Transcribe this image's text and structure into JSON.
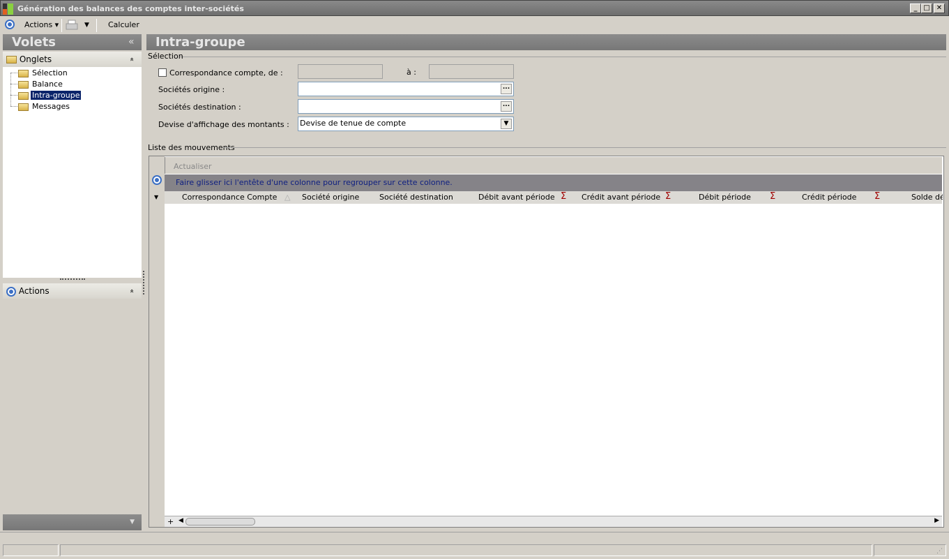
{
  "window": {
    "title": "Génération des balances des comptes inter-sociétés",
    "minimize": "_",
    "maximize": "□",
    "close": "✕"
  },
  "toolbar": {
    "actions_label": "Actions",
    "calculer_label": "Calculer"
  },
  "left": {
    "header": "Volets",
    "collapse": "«",
    "onglets": "Onglets",
    "tree": [
      "Sélection",
      "Balance",
      "Intra-groupe",
      "Messages"
    ],
    "selected": "Intra-groupe",
    "actions": "Actions",
    "chevron": "»"
  },
  "main": {
    "header": "Intra-groupe",
    "selection_group": "Sélection",
    "fields": {
      "correspondance": "Correspondance compte, de :",
      "a": "à :",
      "origine": "Sociétés origine :",
      "destination": "Sociétés destination :",
      "devise": "Devise d'affichage des montants :",
      "devise_value": "Devise de tenue de compte"
    },
    "list_group": "Liste des mouvements",
    "grid": {
      "refresh": "Actualiser",
      "group_hint": "Faire glisser ici l'entête d'une colonne pour regrouper sur cette colonne.",
      "columns": [
        "Correspondance Compte",
        "Société origine",
        "Société destination",
        "Débit avant période",
        "Crédit avant période",
        "Débit période",
        "Crédit période",
        "Solde déb"
      ],
      "sigma": "Σ",
      "add": "+"
    }
  }
}
